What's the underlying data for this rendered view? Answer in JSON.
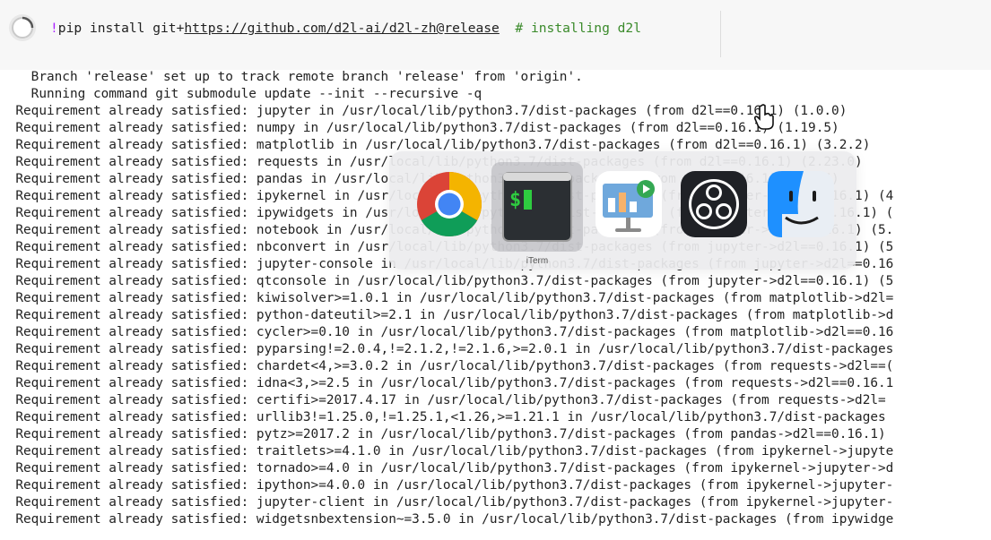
{
  "cell": {
    "command_bang": "!",
    "command_text": "pip install git+",
    "command_url": "https://github.com/d2l-ai/d2l-zh@release",
    "command_comment": "  # installing d2l"
  },
  "output_lines": [
    "    Branch 'release' set up to track remote branch 'release' from 'origin'.",
    "    Running command git submodule update --init --recursive -q",
    "  Requirement already satisfied: jupyter in /usr/local/lib/python3.7/dist-packages (from d2l==0.16.1) (1.0.0)",
    "  Requirement already satisfied: numpy in /usr/local/lib/python3.7/dist-packages (from d2l==0.16.1) (1.19.5)",
    "  Requirement already satisfied: matplotlib in /usr/local/lib/python3.7/dist-packages (from d2l==0.16.1) (3.2.2)",
    "  Requirement already satisfied: requests in /usr/local/lib/python3.7/dist-packages (from d2l==0.16.1) (2.23.0)",
    "  Requirement already satisfied: pandas in /usr/local/lib/python3.7/dist-packages (from d2l==0.16.1) (1.1.5)",
    "  Requirement already satisfied: ipykernel in /usr/local/lib/python3.7/dist-packages (from jupyter->d2l==0.16.1) (4",
    "  Requirement already satisfied: ipywidgets in /usr/local/lib/python3.7/dist-packages (from jupyter->d2l==0.16.1) (",
    "  Requirement already satisfied: notebook in /usr/local/lib/python3.7/dist-packages (from jupyter->d2l==0.16.1) (5.",
    "  Requirement already satisfied: nbconvert in /usr/local/lib/python3.7/dist-packages (from jupyter->d2l==0.16.1) (5",
    "  Requirement already satisfied: jupyter-console in /usr/local/lib/python3.7/dist-packages (from jupyter->d2l==0.16",
    "  Requirement already satisfied: qtconsole in /usr/local/lib/python3.7/dist-packages (from jupyter->d2l==0.16.1) (5",
    "  Requirement already satisfied: kiwisolver>=1.0.1 in /usr/local/lib/python3.7/dist-packages (from matplotlib->d2l=",
    "  Requirement already satisfied: python-dateutil>=2.1 in /usr/local/lib/python3.7/dist-packages (from matplotlib->d",
    "  Requirement already satisfied: cycler>=0.10 in /usr/local/lib/python3.7/dist-packages (from matplotlib->d2l==0.16",
    "  Requirement already satisfied: pyparsing!=2.0.4,!=2.1.2,!=2.1.6,>=2.0.1 in /usr/local/lib/python3.7/dist-packages",
    "  Requirement already satisfied: chardet<4,>=3.0.2 in /usr/local/lib/python3.7/dist-packages (from requests->d2l==(",
    "  Requirement already satisfied: idna<3,>=2.5 in /usr/local/lib/python3.7/dist-packages (from requests->d2l==0.16.1",
    "  Requirement already satisfied: certifi>=2017.4.17 in /usr/local/lib/python3.7/dist-packages (from requests->d2l=",
    "  Requirement already satisfied: urllib3!=1.25.0,!=1.25.1,<1.26,>=1.21.1 in /usr/local/lib/python3.7/dist-packages",
    "  Requirement already satisfied: pytz>=2017.2 in /usr/local/lib/python3.7/dist-packages (from pandas->d2l==0.16.1)",
    "  Requirement already satisfied: traitlets>=4.1.0 in /usr/local/lib/python3.7/dist-packages (from ipykernel->jupyte",
    "  Requirement already satisfied: tornado>=4.0 in /usr/local/lib/python3.7/dist-packages (from ipykernel->jupyter->d",
    "  Requirement already satisfied: ipython>=4.0.0 in /usr/local/lib/python3.7/dist-packages (from ipykernel->jupyter-",
    "  Requirement already satisfied: jupyter-client in /usr/local/lib/python3.7/dist-packages (from ipykernel->jupyter-",
    "  Requirement already satisfied: widgetsnbextension~=3.5.0 in /usr/local/lib/python3.7/dist-packages (from ipywidge"
  ],
  "app_switcher": {
    "apps": [
      "chrome",
      "iterm",
      "keynote",
      "obs",
      "finder"
    ],
    "selected_label": "iTerm"
  },
  "colors": {
    "comment": "#3a8a2a",
    "bang": "#aa22ff",
    "switcher_bg": "#ececee"
  }
}
